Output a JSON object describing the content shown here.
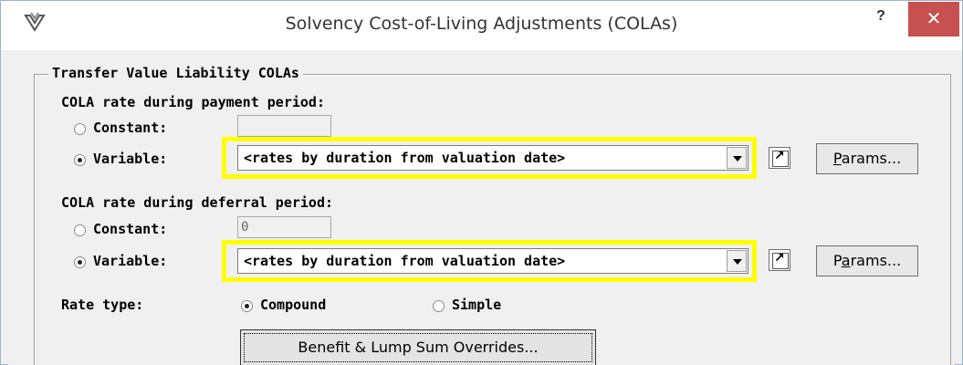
{
  "window": {
    "title": "Solvency Cost-of-Living Adjustments (COLAs)",
    "help_label": "?",
    "close_label": "✕",
    "icon": "app-logo-icon"
  },
  "group": {
    "legend": "Transfer Value Liability COLAs"
  },
  "payment": {
    "heading": "COLA rate during payment period:",
    "constant_label": "Constant:",
    "constant_value": "",
    "constant_checked": false,
    "variable_label": "Variable:",
    "variable_checked": true,
    "variable_value": "<rates by duration from valuation date>",
    "params_label_pre": "",
    "params_label_ul": "P",
    "params_label_post": "arams..."
  },
  "deferral": {
    "heading": "COLA rate during deferral period:",
    "constant_label": "Constant:",
    "constant_value": "0",
    "constant_checked": false,
    "variable_label": "Variable:",
    "variable_checked": true,
    "variable_value": "<rates by duration from valuation date>",
    "params_label_pre": "P",
    "params_label_ul": "a",
    "params_label_post": "rams..."
  },
  "rate_type": {
    "label": "Rate type:",
    "options": [
      "Compound",
      "Simple"
    ],
    "selected": "Compound"
  },
  "overrides": {
    "label_ul": "B",
    "label_post": "enefit & Lump Sum Overrides..."
  },
  "colors": {
    "highlight": "#ffff00",
    "close_button": "#c75050"
  }
}
